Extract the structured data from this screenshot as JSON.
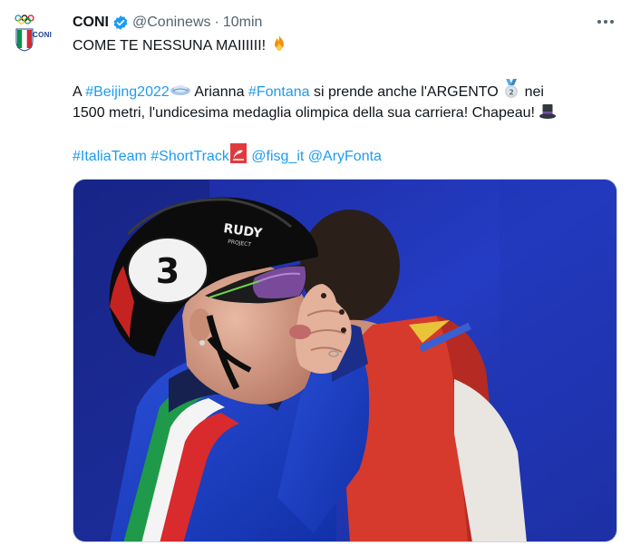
{
  "account": {
    "display_name": "CONI",
    "handle": "@Coninews",
    "separator": "·",
    "time": "10min",
    "avatar_label": "CONI",
    "verified": true
  },
  "tweet": {
    "line1": "COME TE NESSUNA MAIIIIII! ",
    "line1_emoji": "fire-emoji",
    "line2_a": "A ",
    "hashtag_beijing": "#Beijing2022",
    "line2_b": " Arianna ",
    "hashtag_fontana": "#Fontana",
    "line2_c": " si prende anche l'ARGENTO ",
    "line2_d": " nei",
    "line3": "1500 metri, l'undicesima medaglia olimpica della sua carriera! Chapeau! ",
    "hashtag_italiateam": "#ItaliaTeam",
    "hashtag_shorttrack": "#ShortTrack",
    "mention_fisg": "@fisg_it",
    "mention_aryfonta": "@AryFonta"
  },
  "media": {
    "helmet_brand": "RUDY",
    "helmet_sub": "PROJECT",
    "bib_number": "3"
  },
  "colors": {
    "link": "#1d9bf0",
    "text": "#0f1419",
    "muted": "#536471",
    "verified": "#1d9bf0"
  }
}
